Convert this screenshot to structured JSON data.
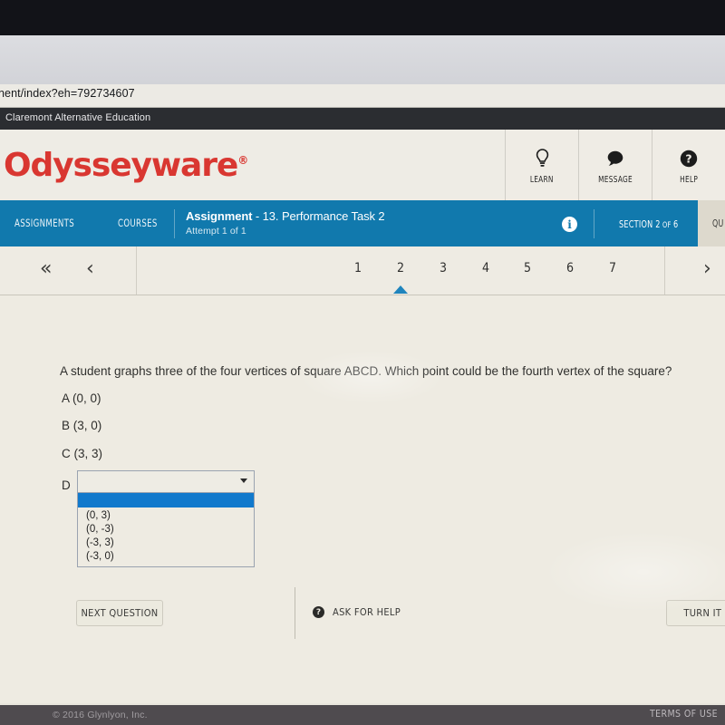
{
  "browser": {
    "url": "nent/index?eh=792734607",
    "tab_title": "Claremont Alternative Education"
  },
  "header": {
    "brand": "Odysseyware",
    "brand_mark": "®",
    "actions": [
      {
        "label": "LEARN",
        "icon": "lightbulb-icon"
      },
      {
        "label": "MESSAGE",
        "icon": "message-bubble-icon"
      },
      {
        "label": "HELP",
        "icon": "question-circle-icon"
      }
    ]
  },
  "navbar": {
    "assignments_label": "ASSIGNMENTS",
    "courses_label": "COURSES",
    "assignment_title_bold": "Assignment",
    "assignment_title_rest": " - 13. Performance Task 2",
    "attempt": "Attempt 1 of 1",
    "info_icon": "i",
    "section_label_main": "SECTION 2",
    "section_label_of": " OF ",
    "section_label_total": "6",
    "right_cut_text": "QU",
    "color": "#1179ad"
  },
  "pager": {
    "first_icon": "«",
    "prev_icon": "‹",
    "next_icon": "›",
    "pages": [
      "1",
      "2",
      "3",
      "4",
      "5",
      "6",
      "7"
    ],
    "active_page": "2",
    "caret_color": "#1f84bd"
  },
  "question": {
    "prompt": "A student graphs three of the four vertices of square ABCD. Which point could be the fourth vertex of the square?",
    "choices": [
      "A (0, 0)",
      "B (3, 0)",
      "C (3, 3)"
    ],
    "d_label": "D",
    "select_value": "",
    "select_placeholder": "",
    "dropdown_options": [
      "",
      "(0, 3)",
      "(0, -3)",
      "(-3, 3)",
      "(-3, 0)"
    ],
    "dropdown_selected_index": 0
  },
  "actions": {
    "next_question": "NEXT QUESTION",
    "ask_for_help": "ASK FOR HELP",
    "ask_for_help_icon": "?",
    "turn_it_in": "TURN IT IN"
  },
  "footer": {
    "copyright": "© 2016 Glynlyon, Inc.",
    "terms": "TERMS OF USE"
  }
}
